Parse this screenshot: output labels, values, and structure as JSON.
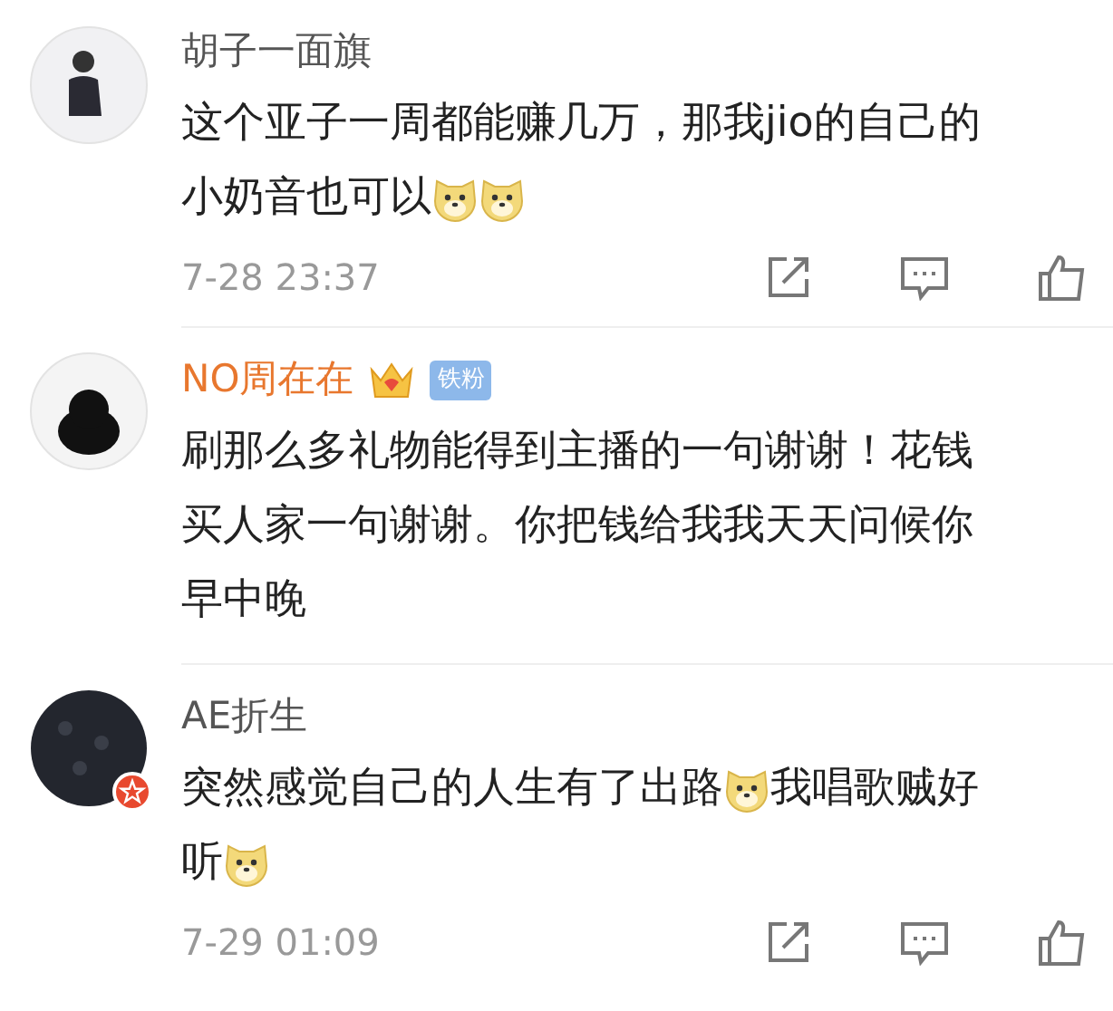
{
  "comments": [
    {
      "user": "胡子一面旗",
      "member": false,
      "verified": false,
      "lines": [
        [
          {
            "kind": "text",
            "text": "这个亚子一周都能赚几万，那我jio的自己的"
          }
        ],
        [
          {
            "kind": "text",
            "text": "小奶音也可以"
          },
          {
            "kind": "emoji"
          },
          {
            "kind": "emoji"
          }
        ]
      ],
      "time": "7-28 23:37",
      "actions": [
        {
          "kind": "share"
        },
        {
          "kind": "comment"
        },
        {
          "kind": "like"
        }
      ]
    },
    {
      "user": "NO周在在",
      "member": true,
      "verified": false,
      "badges": [
        {
          "kind": "crown"
        },
        {
          "kind": "fan",
          "text": "铁粉"
        }
      ],
      "lines": [
        [
          {
            "kind": "text",
            "text": "刷那么多礼物能得到主播的一句谢谢！花钱"
          }
        ],
        [
          {
            "kind": "text",
            "text": "买人家一句谢谢。你把钱给我我天天问候你"
          }
        ],
        [
          {
            "kind": "text",
            "text": "早中晚"
          }
        ]
      ]
    },
    {
      "user": "AE折生",
      "member": false,
      "verified": true,
      "lines": [
        [
          {
            "kind": "text",
            "text": "突然感觉自己的人生有了出路"
          },
          {
            "kind": "emoji"
          },
          {
            "kind": "text",
            "text": "我唱歌贼好"
          }
        ],
        [
          {
            "kind": "text",
            "text": "听"
          },
          {
            "kind": "emoji"
          }
        ]
      ],
      "time": "7-29 01:09",
      "actions": [
        {
          "kind": "share"
        },
        {
          "kind": "comment"
        },
        {
          "kind": "like"
        }
      ]
    }
  ]
}
